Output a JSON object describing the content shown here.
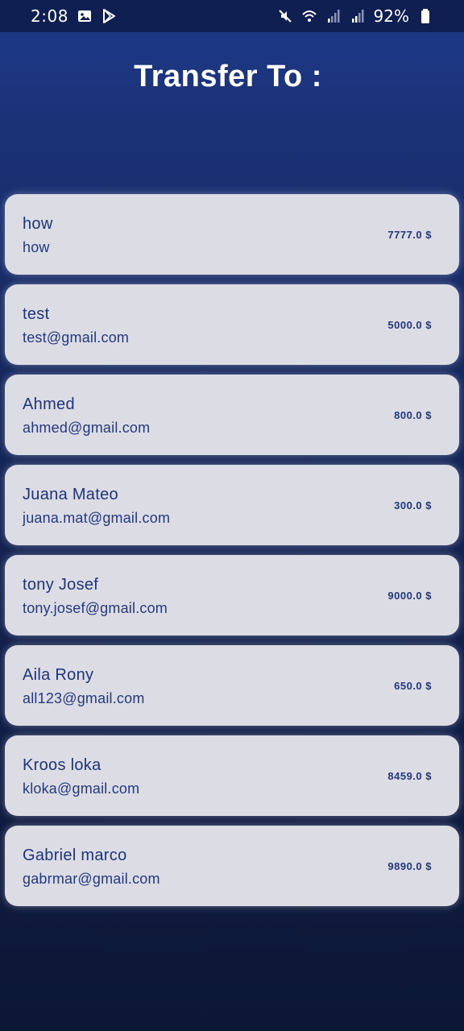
{
  "status_bar": {
    "time": "2:08",
    "battery": "92%"
  },
  "header": {
    "title": "Transfer To :"
  },
  "recipients": [
    {
      "name": "how",
      "email": "how",
      "amount": "7777.0 $"
    },
    {
      "name": "test",
      "email": "test@gmail.com",
      "amount": "5000.0 $"
    },
    {
      "name": "Ahmed",
      "email": "ahmed@gmail.com",
      "amount": "800.0 $"
    },
    {
      "name": "Juana Mateo",
      "email": "juana.mat@gmail.com",
      "amount": "300.0 $"
    },
    {
      "name": "tony Josef",
      "email": "tony.josef@gmail.com",
      "amount": "9000.0 $"
    },
    {
      "name": "Aila Rony",
      "email": "all123@gmail.com",
      "amount": "650.0 $"
    },
    {
      "name": "Kroos loka",
      "email": "kloka@gmail.com",
      "amount": "8459.0 $"
    },
    {
      "name": "Gabriel marco",
      "email": "gabrmar@gmail.com",
      "amount": "9890.0 $"
    }
  ],
  "colors": {
    "background_top": "#1d3a8a",
    "background_bottom": "#0c1735",
    "card": "#dcdce4",
    "card_text": "#1f3578"
  },
  "icons": [
    "image-icon",
    "play-store-icon",
    "mute-icon",
    "wifi-icon",
    "signal-icon",
    "signal-icon",
    "battery-icon"
  ]
}
